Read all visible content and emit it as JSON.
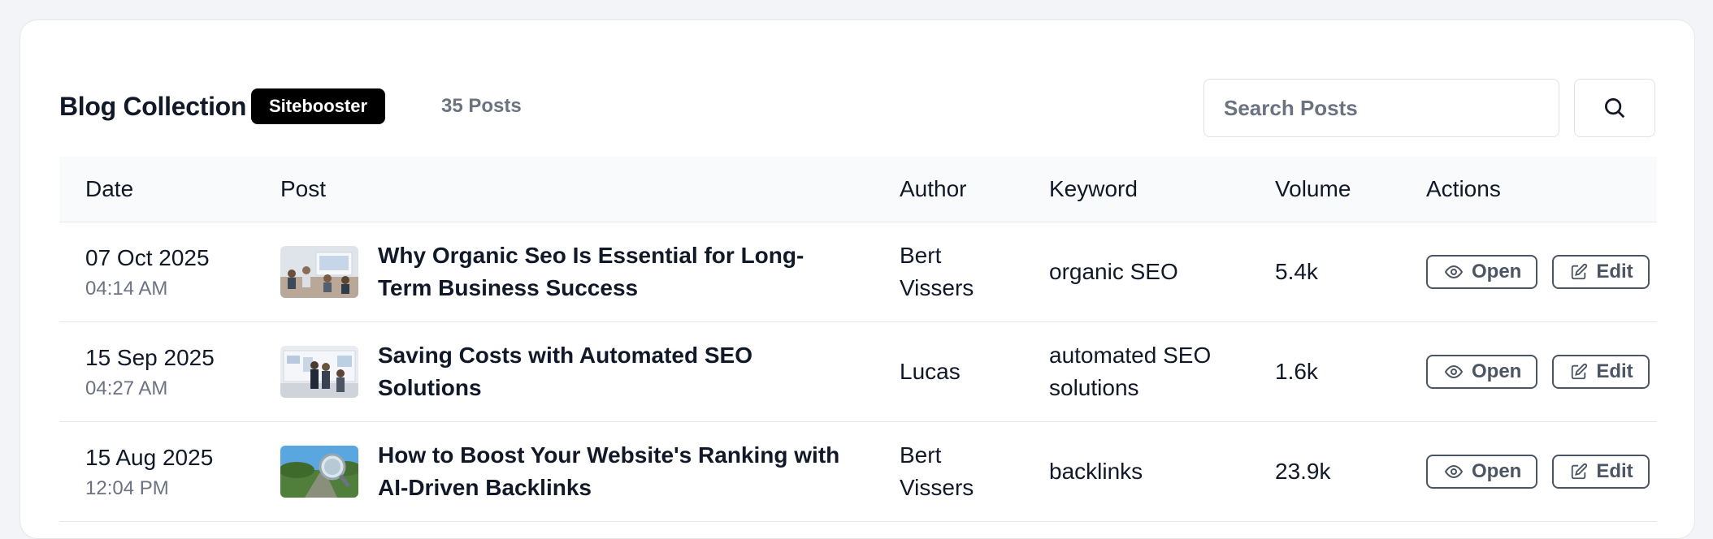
{
  "header": {
    "title": "Blog Collection",
    "badge": "Sitebooster",
    "count": "35 Posts",
    "search_placeholder": "Search Posts"
  },
  "table": {
    "columns": [
      "Date",
      "Post",
      "Author",
      "Keyword",
      "Volume",
      "Actions"
    ],
    "rows": [
      {
        "date": "07 Oct 2025",
        "time": "04:14 AM",
        "title": "Why Organic Seo Is Essential for Long-Term Business Success",
        "author": "Bert Vissers",
        "keyword": "organic SEO",
        "volume": "5.4k",
        "open_label": "Open",
        "edit_label": "Edit"
      },
      {
        "date": "15 Sep 2025",
        "time": "04:27 AM",
        "title": "Saving Costs with Automated SEO Solutions",
        "author": "Lucas",
        "keyword": "automated SEO solutions",
        "volume": "1.6k",
        "open_label": "Open",
        "edit_label": "Edit"
      },
      {
        "date": "15 Aug 2025",
        "time": "12:04 PM",
        "title": "How to Boost Your Website's Ranking with AI-Driven Backlinks",
        "author": "Bert Vissers",
        "keyword": "backlinks",
        "volume": "23.9k",
        "open_label": "Open",
        "edit_label": "Edit"
      }
    ]
  },
  "icons": {
    "search": "search-icon",
    "open": "eye-icon",
    "edit": "edit-icon"
  }
}
